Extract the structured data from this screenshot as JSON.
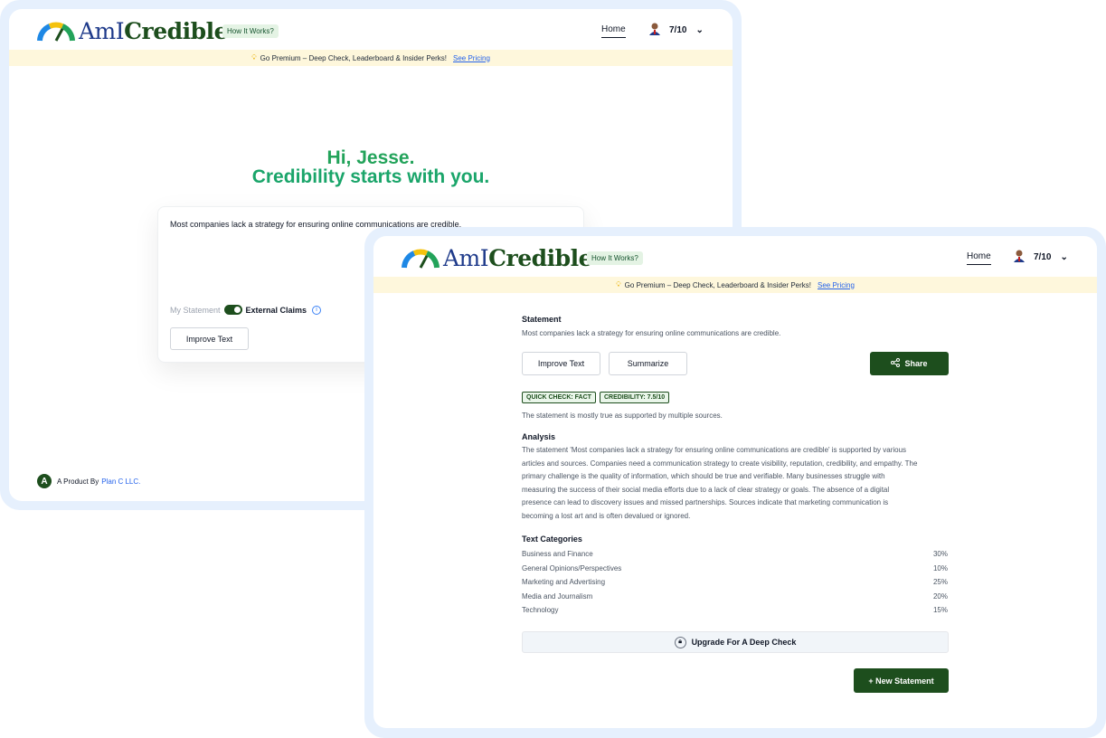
{
  "brand": {
    "prefix": "AmI",
    "suffix": "Credible"
  },
  "header": {
    "how_it_works": "How It Works?",
    "home": "Home",
    "score": "7/10"
  },
  "banner": {
    "icon": "lightbulb-icon",
    "text": "Go Premium – Deep Check, Leaderboard & Insider Perks!",
    "link": "See Pricing"
  },
  "home_screen": {
    "greeting": "Hi, Jesse.",
    "tagline": "Credibility starts with you.",
    "statement_text": "Most companies lack a strategy for ensuring online communications are credible.",
    "toggle_left": "My Statement",
    "toggle_right": "External Claims",
    "improve_button": "Improve Text",
    "footer_text": "A Product By",
    "footer_company": "Plan C LLC.",
    "footer_logo_letter": "A"
  },
  "result_screen": {
    "statement_title": "Statement",
    "statement_text": "Most companies lack a strategy for ensuring online communications are credible.",
    "improve_button": "Improve Text",
    "summarize_button": "Summarize",
    "share_button": "Share",
    "quick_check_badge": "QUICK CHECK: FACT",
    "credibility_badge": "CREDIBILITY: 7.5/10",
    "verdict": "The statement is mostly true as supported by multiple sources.",
    "analysis_title": "Analysis",
    "analysis_lines": [
      "The statement 'Most companies lack a strategy for ensuring online communications are credible' is supported by various",
      "articles and sources. Companies need a communication strategy to create visibility, reputation, credibility, and empathy. The",
      "primary challenge is the quality of information, which should be true and verifiable. Many businesses struggle with",
      "measuring the success of their social media efforts due to a lack of clear strategy or goals. The absence of a digital",
      "presence can lead to discovery issues and missed partnerships. Sources indicate that marketing communication is",
      "becoming a lost art and is often devalued or ignored."
    ],
    "categories_title": "Text Categories",
    "categories": [
      {
        "name": "Business and Finance",
        "pct": "30%"
      },
      {
        "name": "General Opinions/Perspectives",
        "pct": "10%"
      },
      {
        "name": "Marketing and Advertising",
        "pct": "25%"
      },
      {
        "name": "Media and Journalism",
        "pct": "20%"
      },
      {
        "name": "Technology",
        "pct": "15%"
      }
    ],
    "upgrade_button": "Upgrade For A Deep Check",
    "new_statement_button": "+ New Statement"
  },
  "colors": {
    "brand_green": "#1d4e1d",
    "accent_green": "#22a35a",
    "link_blue": "#2563eb",
    "banner_bg": "#fef7dc",
    "frame_bg": "#e6f0fd"
  }
}
